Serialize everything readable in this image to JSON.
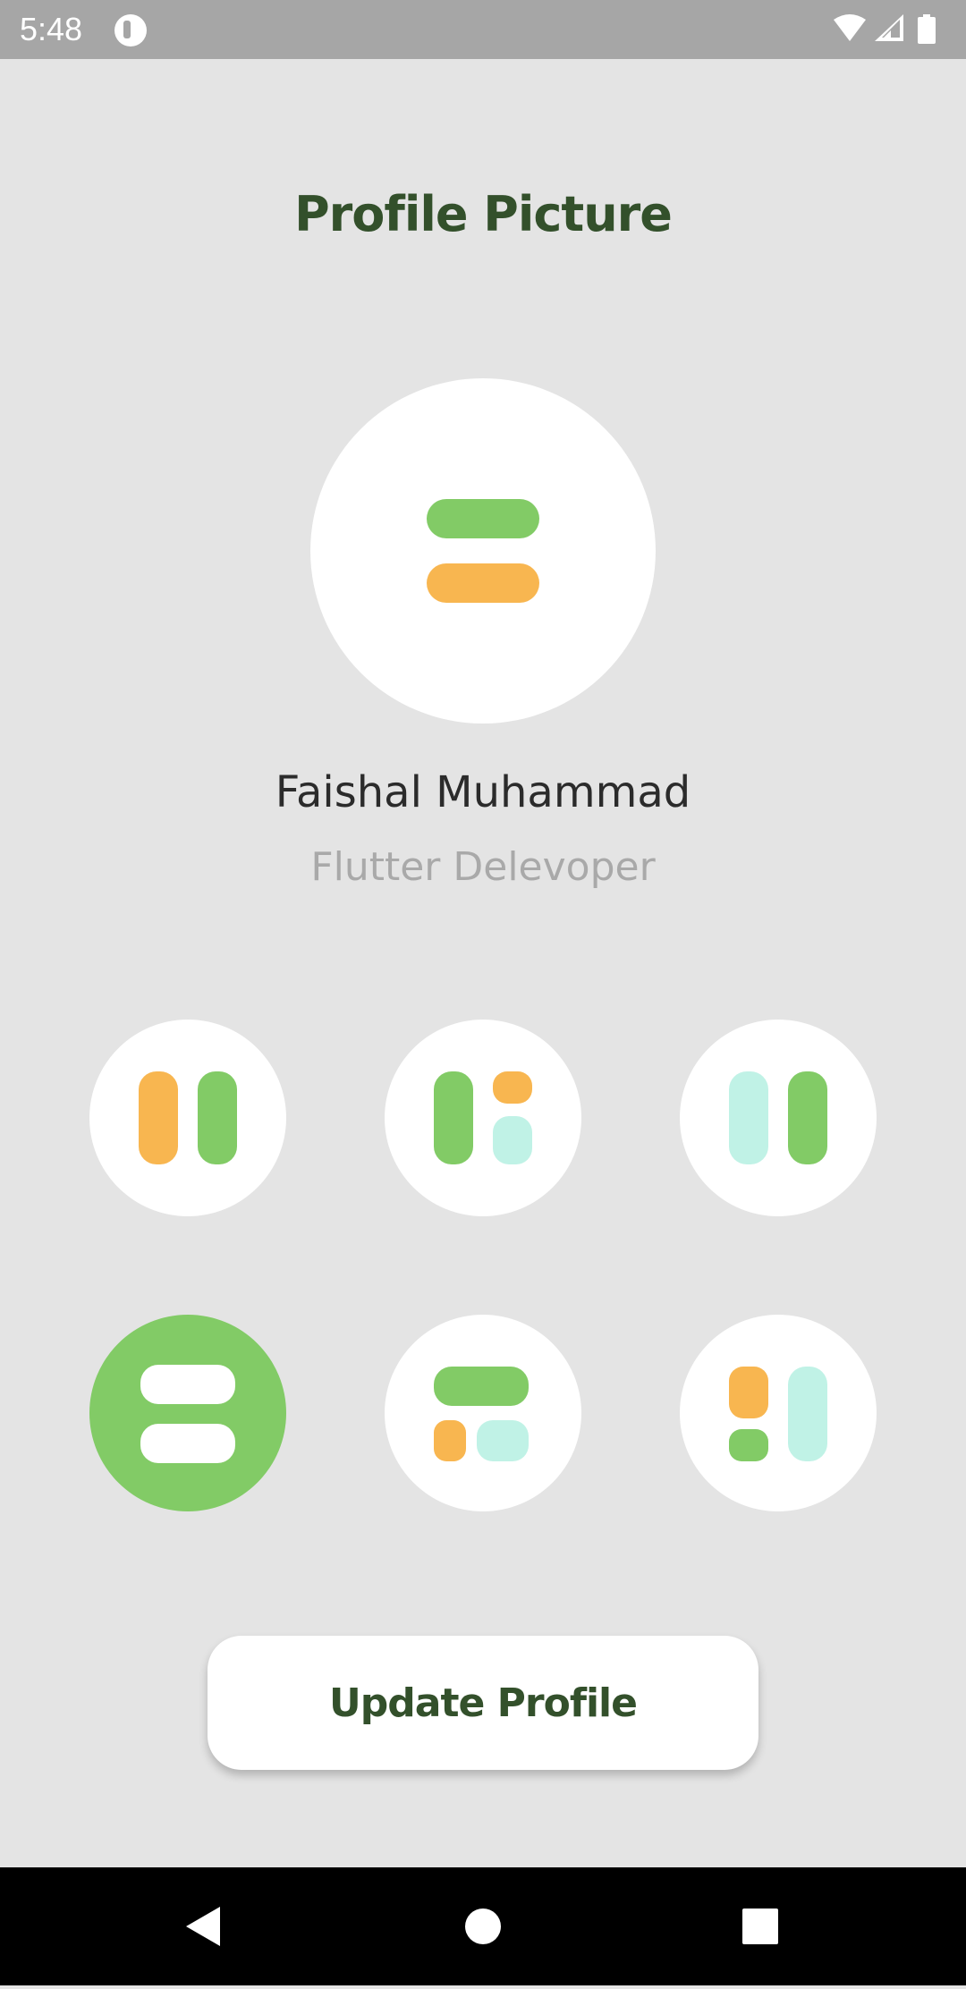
{
  "status_bar": {
    "time": "5:48",
    "icons": [
      "app-notification-icon",
      "wifi-icon",
      "cellular-signal-icon",
      "battery-icon"
    ]
  },
  "page": {
    "title": "Profile Picture"
  },
  "profile": {
    "name": "Faishal Muhammad",
    "role": "Flutter Delevoper"
  },
  "avatar_options": [
    {
      "id": 1,
      "layout": "two-vertical-bars",
      "selected": false
    },
    {
      "id": 2,
      "layout": "bar-and-two-blocks",
      "selected": false
    },
    {
      "id": 3,
      "layout": "two-vertical-bars-mint",
      "selected": false
    },
    {
      "id": 4,
      "layout": "two-horizontal-bars",
      "selected": true
    },
    {
      "id": 5,
      "layout": "bar-over-two-blocks",
      "selected": false
    },
    {
      "id": 6,
      "layout": "two-blocks-and-bar",
      "selected": false
    }
  ],
  "actions": {
    "update_label": "Update Profile"
  },
  "nav_bar": {
    "icons": [
      "back-icon",
      "home-icon",
      "recents-icon"
    ]
  },
  "colors": {
    "background": "#e4e4e4",
    "title": "#33502b",
    "green": "#82cb66",
    "orange": "#f8b650",
    "mint": "#c0f2e6",
    "white": "#ffffff",
    "status_bar": "#a6a6a6",
    "nav_bar": "#000000"
  }
}
